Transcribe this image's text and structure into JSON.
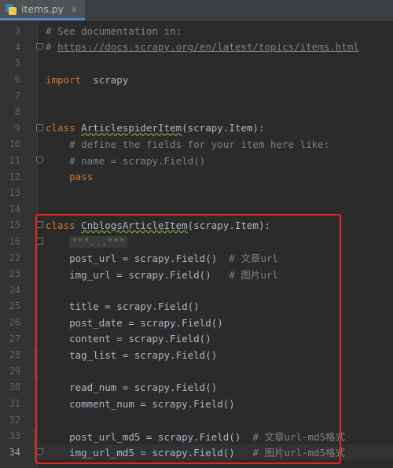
{
  "tab": {
    "filename": "items.py",
    "close_glyph": "×",
    "icon": "python-file-icon"
  },
  "lines": [
    {
      "num": "3",
      "code": [
        [
          "cm",
          "# See documentation in:"
        ]
      ]
    },
    {
      "num": "4",
      "code": [
        [
          "cm",
          "# "
        ],
        [
          "cmlink",
          "https://docs.scrapy.org/en/latest/topics/items.html"
        ]
      ]
    },
    {
      "num": "5",
      "code": []
    },
    {
      "num": "6",
      "code": [
        [
          "kw",
          "import"
        ],
        [
          "",
          "  scrapy"
        ]
      ]
    },
    {
      "num": "7",
      "code": []
    },
    {
      "num": "8",
      "code": []
    },
    {
      "num": "9",
      "code": [
        [
          "kw",
          "class"
        ],
        [
          "",
          " "
        ],
        [
          "cls",
          "ArticlespiderItem"
        ],
        [
          "",
          "(scrapy.Item):"
        ]
      ]
    },
    {
      "num": "10",
      "code": [
        [
          "cm",
          "    # define the fields for your item here like:"
        ]
      ]
    },
    {
      "num": "11",
      "code": [
        [
          "cm",
          "    # name = "
        ],
        [
          "cm",
          "scrapy"
        ],
        [
          "cm",
          ".Field()"
        ]
      ]
    },
    {
      "num": "12",
      "code": [
        [
          "",
          ""
        ],
        [
          "kw",
          "    pass"
        ]
      ]
    },
    {
      "num": "13",
      "code": []
    },
    {
      "num": "14",
      "code": []
    },
    {
      "num": "15",
      "code": [
        [
          "kw",
          "class"
        ],
        [
          "",
          " "
        ],
        [
          "cls2",
          "CnblogsArticleItem"
        ],
        [
          "",
          "(scrapy.Item):"
        ]
      ]
    },
    {
      "num": "16",
      "code": [
        [
          "",
          "    "
        ],
        [
          "docbox",
          "\"\"\"...\"\"\""
        ]
      ]
    },
    {
      "num": "22",
      "code": [
        [
          "",
          "    post_url = scrapy.Field()  "
        ],
        [
          "cm",
          "# 文章url"
        ]
      ]
    },
    {
      "num": "23",
      "code": [
        [
          "",
          "    img_url = scrapy.Field()   "
        ],
        [
          "cm",
          "# 图片url"
        ]
      ]
    },
    {
      "num": "24",
      "code": []
    },
    {
      "num": "25",
      "code": [
        [
          "",
          "    title = scrapy.Field()"
        ]
      ]
    },
    {
      "num": "26",
      "code": [
        [
          "",
          "    post_date = scrapy.Field()"
        ]
      ]
    },
    {
      "num": "27",
      "code": [
        [
          "",
          "    content = scrapy.Field()"
        ]
      ]
    },
    {
      "num": "28",
      "code": [
        [
          "",
          "    tag_list = scrapy.Field()"
        ]
      ]
    },
    {
      "num": "29",
      "code": []
    },
    {
      "num": "30",
      "code": [
        [
          "",
          "    read_num = scrapy.Field()"
        ]
      ]
    },
    {
      "num": "31",
      "code": [
        [
          "",
          "    comment_num = scrapy.Field()"
        ]
      ]
    },
    {
      "num": "32",
      "code": []
    },
    {
      "num": "33",
      "code": [
        [
          "",
          "    post_url_md5 = scrapy.Field()  "
        ],
        [
          "cm",
          "# 文章url-md5格式"
        ]
      ]
    },
    {
      "num": "34",
      "code": [
        [
          "",
          "    img_url_md5 = scrapy.Field()   "
        ],
        [
          "cm",
          "# 图片url-md5格式"
        ]
      ],
      "current": true
    }
  ]
}
